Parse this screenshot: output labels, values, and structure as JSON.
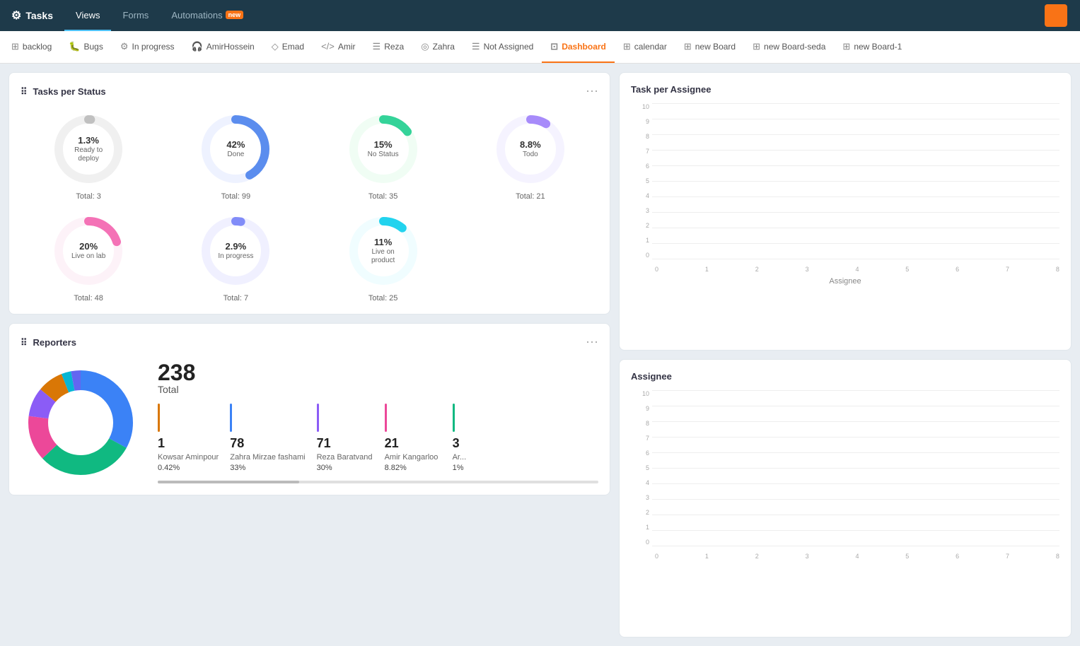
{
  "topBar": {
    "appName": "Tasks",
    "tabs": [
      {
        "label": "Views",
        "active": false
      },
      {
        "label": "Forms",
        "active": false
      },
      {
        "label": "Automations",
        "active": false,
        "badge": "new"
      }
    ]
  },
  "subNav": {
    "items": [
      {
        "label": "backlog",
        "icon": "⊞",
        "active": false
      },
      {
        "label": "Bugs",
        "icon": "🐛",
        "active": false
      },
      {
        "label": "In progress",
        "icon": "⚙",
        "active": false
      },
      {
        "label": "AmirHossein",
        "icon": "🎧",
        "active": false
      },
      {
        "label": "Emad",
        "icon": "◇",
        "active": false
      },
      {
        "label": "Amir",
        "icon": "</>",
        "active": false
      },
      {
        "label": "Reza",
        "icon": "☰",
        "active": false
      },
      {
        "label": "Zahra",
        "icon": "◎",
        "active": false
      },
      {
        "label": "Not Assigned",
        "icon": "☰",
        "active": false
      },
      {
        "label": "Dashboard",
        "icon": "⊡",
        "active": true
      },
      {
        "label": "calendar",
        "icon": "⊞",
        "active": false
      },
      {
        "label": "new Board",
        "icon": "⊞",
        "active": false
      },
      {
        "label": "new Board-seda",
        "icon": "⊞",
        "active": false
      },
      {
        "label": "new Board-1",
        "icon": "⊞",
        "active": false
      }
    ]
  },
  "tasksPerStatus": {
    "title": "Tasks per Status",
    "items": [
      {
        "pct": "1.3%",
        "name": "Ready to deploy",
        "total": "Total: 3",
        "color": "#c0c0c0",
        "bg": "#f0f0f0",
        "value": 1.3
      },
      {
        "pct": "42%",
        "name": "Done",
        "total": "Total: 99",
        "color": "#5b8dee",
        "bg": "#eef2ff",
        "value": 42
      },
      {
        "pct": "15%",
        "name": "No Status",
        "total": "Total: 35",
        "color": "#34d399",
        "bg": "#f0fdf4",
        "value": 15
      },
      {
        "pct": "8.8%",
        "name": "Todo",
        "total": "Total: 21",
        "color": "#a78bfa",
        "bg": "#f5f3ff",
        "value": 8.8
      },
      {
        "pct": "20%",
        "name": "Live on lab",
        "total": "Total: 48",
        "color": "#f472b6",
        "bg": "#fdf2f8",
        "value": 20
      },
      {
        "pct": "2.9%",
        "name": "In progress",
        "total": "Total: 7",
        "color": "#818cf8",
        "bg": "#f0f0ff",
        "value": 2.9
      },
      {
        "pct": "11%",
        "name": "Live on product",
        "total": "Total: 25",
        "color": "#22d3ee",
        "bg": "#f0fdff",
        "value": 11
      }
    ]
  },
  "reporters": {
    "title": "Reporters",
    "total": "238",
    "totalLabel": "Total",
    "people": [
      {
        "count": "1",
        "name": "Kowsar Aminpour",
        "pct": "0.42%",
        "color": "#d97706"
      },
      {
        "count": "78",
        "name": "Zahra Mirzae fashami",
        "pct": "33%",
        "color": "#3b82f6"
      },
      {
        "count": "71",
        "name": "Reza Baratvand",
        "pct": "30%",
        "color": "#8b5cf6"
      },
      {
        "count": "21",
        "name": "Amir Kangarloo",
        "pct": "8.82%",
        "color": "#ec4899"
      },
      {
        "count": "3",
        "name": "Ar...",
        "pct": "1%",
        "color": "#10b981"
      }
    ],
    "donutSegments": [
      {
        "color": "#3b82f6",
        "pct": 33
      },
      {
        "color": "#10b981",
        "pct": 30
      },
      {
        "color": "#ec4899",
        "pct": 14
      },
      {
        "color": "#8b5cf6",
        "pct": 9
      },
      {
        "color": "#d97706",
        "pct": 8
      },
      {
        "color": "#06b6d4",
        "pct": 3
      },
      {
        "color": "#6366f1",
        "pct": 3
      }
    ]
  },
  "taskPerAssignee": {
    "title": "Task per Assignee",
    "yLabels": [
      "10",
      "9",
      "8",
      "7",
      "6",
      "5",
      "4",
      "3",
      "2",
      "1",
      "0"
    ],
    "xLabels": [
      "0",
      "1",
      "2",
      "3",
      "4",
      "5",
      "6",
      "7",
      "8"
    ],
    "assigneeLabel": "Assignee"
  },
  "icons": {
    "drag": "⠿",
    "gear": "⚙",
    "ellipsis": "⋯"
  }
}
